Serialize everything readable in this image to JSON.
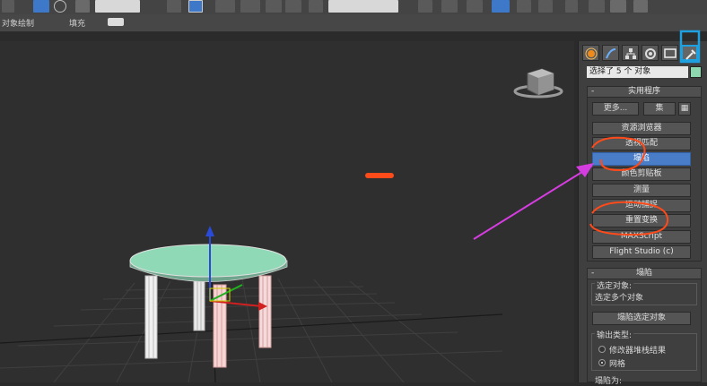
{
  "subbar": {
    "tab1": "对象绘制",
    "tab2": "填充"
  },
  "panel": {
    "tabs": [
      "create-icon",
      "modify-icon",
      "hierarchy-icon",
      "motion-icon",
      "display-icon",
      "utilities-icon"
    ],
    "selection_text": "选择了 5 个 对象",
    "utilities": {
      "title": "实用程序",
      "more_label": "更多...",
      "sets_label": "集",
      "buttons": [
        "资源浏览器",
        "透视匹配",
        "塌陷",
        "颜色剪贴板",
        "测量",
        "运动捕捉",
        "重置变换",
        "MAXScript",
        "Flight Studio (c)"
      ],
      "active_index": 2
    },
    "collapse": {
      "title": "塌陷",
      "selected_label": "选定对象:",
      "selected_value": "选定多个对象",
      "collapse_button": "塌陷选定对象",
      "output_label": "输出类型:",
      "option_stack": "修改器堆栈结果",
      "option_mesh": "网格",
      "collapse_to_label": "塌陷为:"
    }
  },
  "colors": {
    "annotation_orange": "#ff4a1a",
    "annotation_arrow": "#d63de0",
    "highlight_blue": "#1fa0e0",
    "table_top": "#8fd9b6"
  }
}
